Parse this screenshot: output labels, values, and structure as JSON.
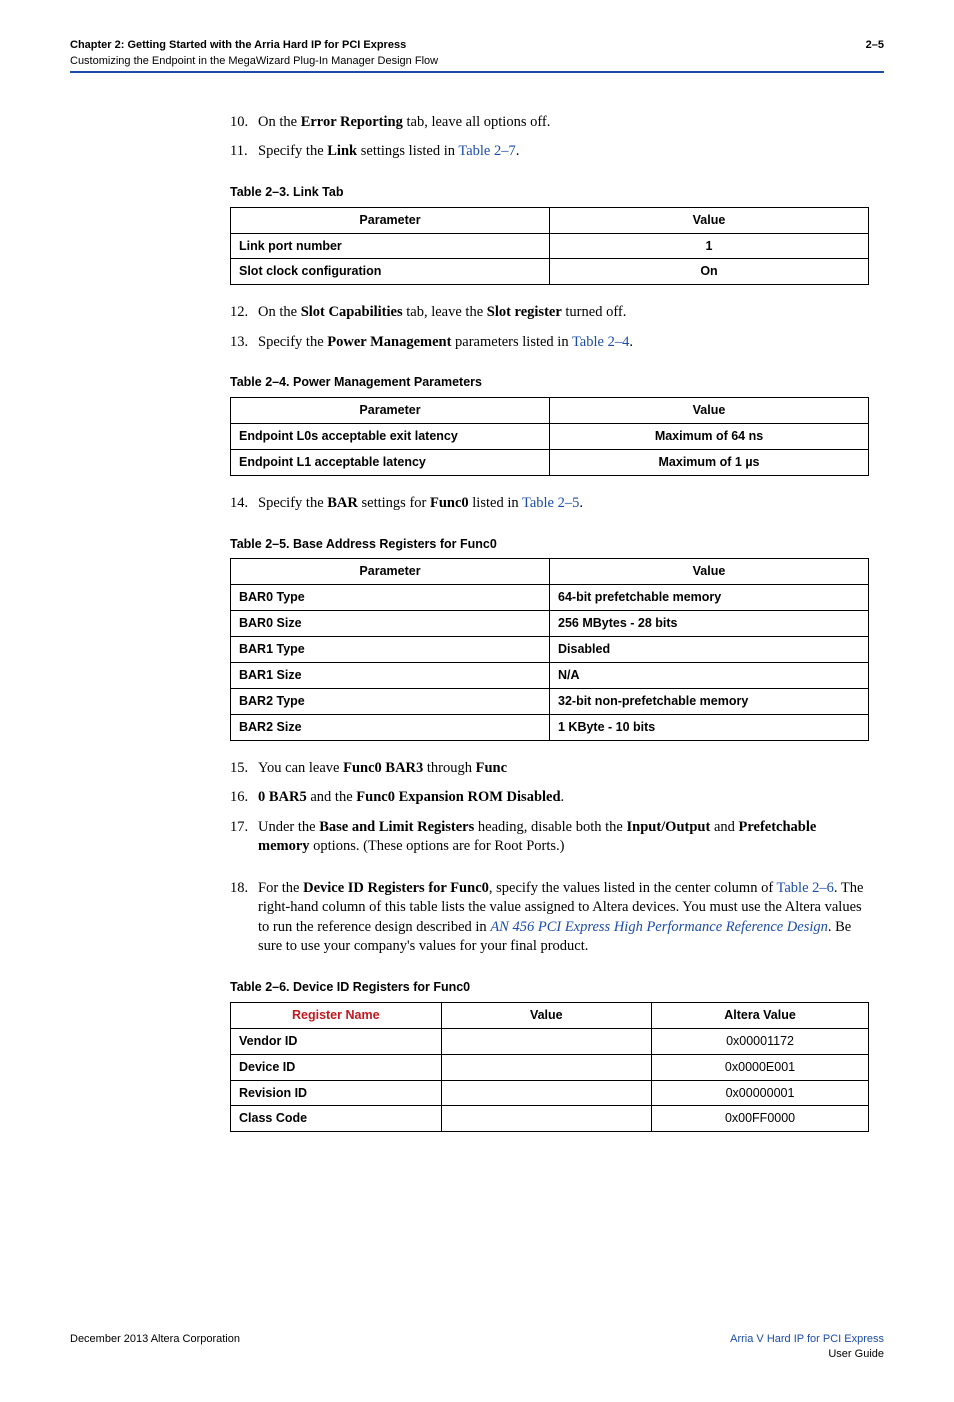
{
  "header": {
    "line1": "Chapter 2: Getting Started with the Arria Hard IP for PCI Express",
    "line2": "Customizing the Endpoint in the MegaWizard Plug-In Manager Design Flow",
    "page": "2–5"
  },
  "steps": {
    "s10": {
      "num": "10.",
      "t1": "On the ",
      "b1": "Error Reporting",
      "t2": " tab, leave all options off."
    },
    "s11": {
      "num": "11.",
      "t1": "Specify the ",
      "b1": "Link",
      "t2": " settings listed in ",
      "l1": "Table 2–7",
      "t3": "."
    },
    "s12": {
      "num": "12.",
      "t1": "On the ",
      "b1": "Slot Capabilities",
      "t2": " tab, leave the ",
      "b2": "Slot register",
      "t3": " turned off."
    },
    "s13": {
      "num": "13.",
      "t1": "Specify the ",
      "b1": "Power Management",
      "t2": " parameters listed in ",
      "l1": "Table 2–4",
      "t3": "."
    },
    "s14": {
      "num": "14.",
      "t1": "Specify the ",
      "b1": "BAR",
      "t2": " settings for ",
      "b2": "Func0",
      "t3": " listed in ",
      "l1": "Table 2–5",
      "t4": "."
    },
    "s15": {
      "num": "15.",
      "t1": "You can leave ",
      "b1": "Func0 BAR3",
      "t2": " through ",
      "b2": "Func"
    },
    "s16": {
      "num": "16.",
      "b1": "0 BAR5",
      "t1": " and the ",
      "b2": "Func0 Expansion ROM Disabled",
      "t2": "."
    },
    "s17": {
      "num": "17.",
      "t1": "Under the ",
      "b1": "Base and Limit Registers",
      "t2": " heading, disable both the ",
      "b2": "Input/Output",
      "t3": " and ",
      "b3": "Prefetchable memory",
      "t4": " options. (These options are for Root Ports.)"
    },
    "s18": {
      "num": "18.",
      "t1": "For the ",
      "b1": "Device ID Registers for Func0",
      "t2": ", specify the values listed in the center column of ",
      "l1": "Table 2–6",
      "t3": ". The right-hand column of this table lists the value assigned to Altera devices. You must use the Altera values to run the reference design described in ",
      "l2": "AN 456 PCI Express High Performance Reference Design",
      "t4": ". Be sure to use your company's values for your final product."
    }
  },
  "table23": {
    "caption": "Table 2–3.  Link  Tab",
    "h1": "Parameter",
    "h2": "Value",
    "rows": [
      {
        "p": "Link port number",
        "v": "1"
      },
      {
        "p": "Slot clock configuration",
        "v": "On"
      }
    ]
  },
  "table24": {
    "caption": "Table 2–4.  Power Management Parameters",
    "h1": "Parameter",
    "h2": "Value",
    "rows": [
      {
        "p": "Endpoint L0s acceptable exit latency",
        "v": "Maximum of 64 ns"
      },
      {
        "p": "Endpoint L1 acceptable latency",
        "v": "Maximum of 1 µs"
      }
    ]
  },
  "table25": {
    "caption": "Table 2–5.  Base Address Registers for Func0",
    "h1": "Parameter",
    "h2": "Value",
    "rows": [
      {
        "p": "BAR0 Type",
        "v": "64-bit prefetchable memory"
      },
      {
        "p": "BAR0 Size",
        "v": "256 MBytes - 28 bits"
      },
      {
        "p": "BAR1 Type",
        "v": "Disabled"
      },
      {
        "p": "BAR1 Size",
        "v": "N/A"
      },
      {
        "p": "BAR2 Type",
        "v": "32-bit non-prefetchable memory"
      },
      {
        "p": "BAR2 Size",
        "v": "1 KByte - 10 bits"
      }
    ]
  },
  "table26": {
    "caption": "Table 2–6.  Device ID Registers for Func0",
    "h1": "Register Name",
    "h2": "Value",
    "h3": "Altera Value",
    "rows": [
      {
        "n": "Vendor ID",
        "v": "",
        "av": "0x00001172"
      },
      {
        "n": "Device ID",
        "v": "",
        "av": "0x0000E001"
      },
      {
        "n": "Revision ID",
        "v": "",
        "av": "0x00000001"
      },
      {
        "n": "Class Code",
        "v": "",
        "av": "0x00FF0000"
      }
    ]
  },
  "footer": {
    "left": "December 2013   Altera Corporation",
    "right1": "Arria V Hard IP for PCI Express",
    "right2": "User Guide"
  }
}
